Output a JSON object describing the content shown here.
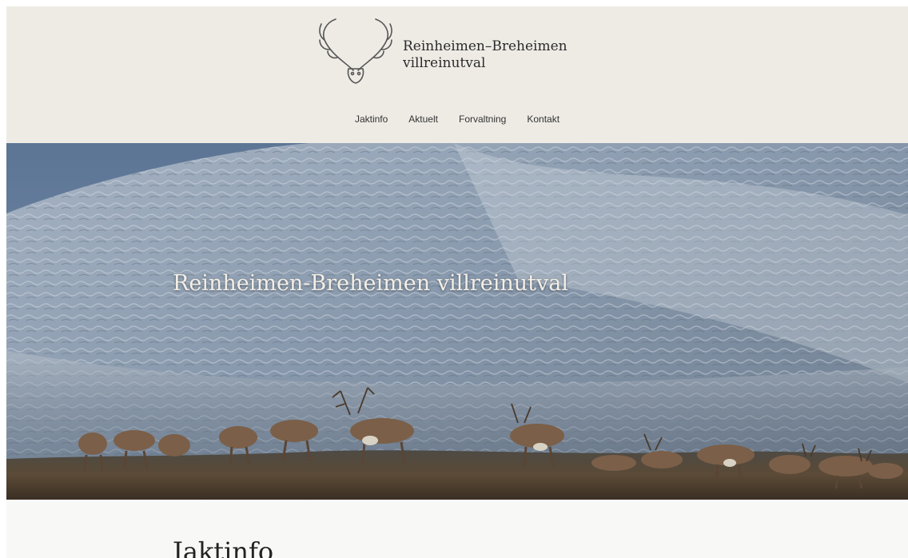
{
  "site": {
    "logo_line1": "Reinheimen–Breheimen",
    "logo_line2": "villreinutval"
  },
  "nav": {
    "items": [
      "Jaktinfo",
      "Aktuelt",
      "Forvaltning",
      "Kontakt"
    ]
  },
  "hero": {
    "title": "Reinheimen-Breheimen villreinutval"
  },
  "content": {
    "heading": "Jaktinfo"
  },
  "colors": {
    "header_bg": "#eeebe5",
    "content_bg": "#f8f8f6",
    "text": "#333333"
  },
  "icons": {
    "logo": "antlers-icon"
  }
}
